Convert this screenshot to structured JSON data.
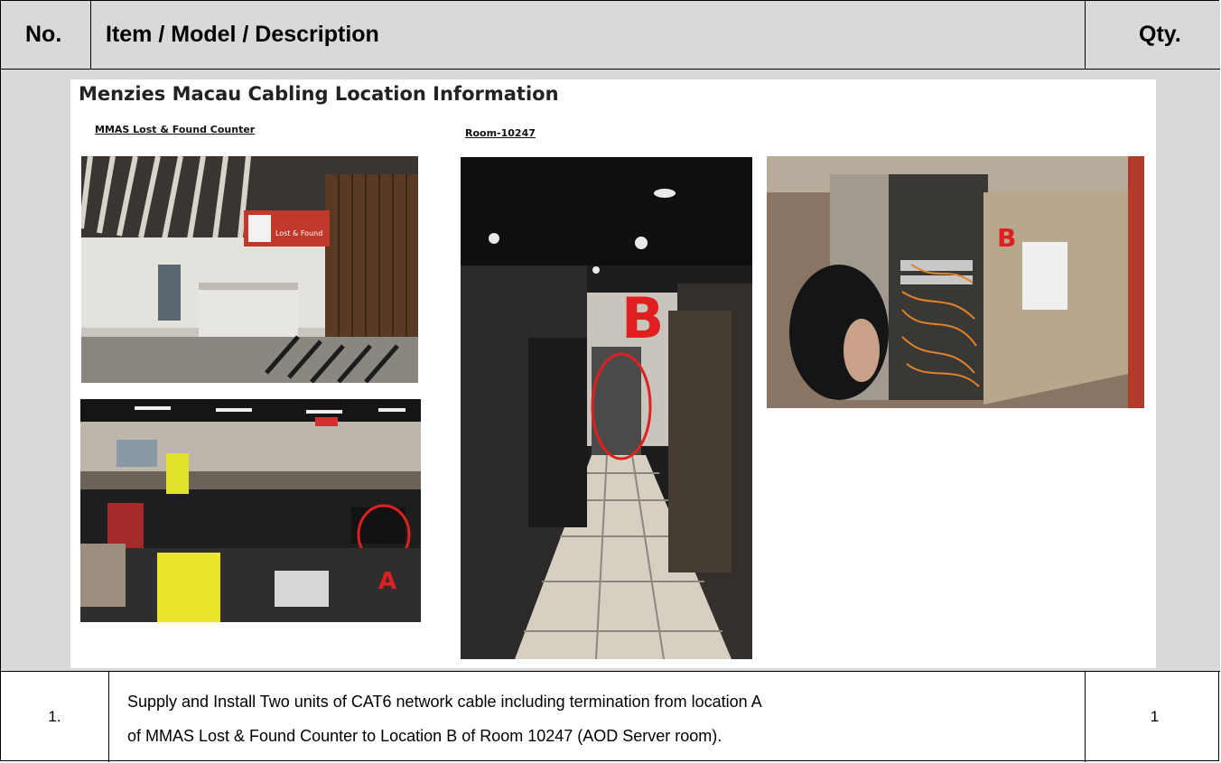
{
  "header": {
    "col_no": "No.",
    "col_item": "Item / Model / Description",
    "col_qty": "Qty."
  },
  "slide": {
    "title": "Menzies Macau Cabling Location Information",
    "left_caption": "MMAS Lost & Found Counter",
    "right_caption": "Room-10247",
    "sign_text": "Lost & Found",
    "marker_a": "A",
    "marker_b": "B"
  },
  "rows": [
    {
      "no": "1.",
      "line1": "Supply and Install Two units of CAT6 network cable including termination from location A",
      "line2": "of MMAS Lost & Found Counter to Location B of Room 10247 (AOD Server room).",
      "qty": "1"
    }
  ],
  "colors": {
    "header_bg": "#d9d9d9",
    "marker_red": "#e02020"
  }
}
